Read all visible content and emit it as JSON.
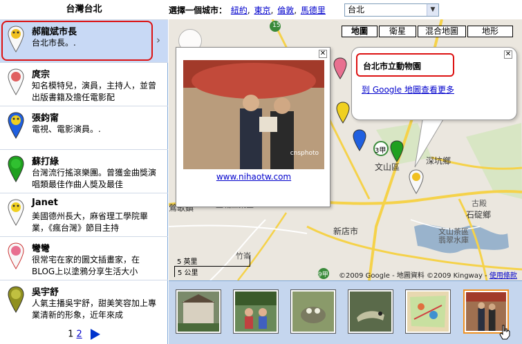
{
  "header": {
    "city_title": "台灣台北",
    "select_label": "選擇一個城市：",
    "city_links": [
      "紐約",
      "東京",
      "倫敦",
      "馬德里"
    ],
    "city_select_value": "台北"
  },
  "people": [
    {
      "name": "郝龍斌市長",
      "desc": "台北市長。.",
      "pin_color": "#f0c020",
      "active": true
    },
    {
      "name": "庹宗",
      "desc": "知名模特兒，演員，主持人，並曾出版書籍及擔任電影配",
      "pin_color": "#e06060",
      "active": false
    },
    {
      "name": "張鈞甯",
      "desc": "電視、電影演員。.",
      "pin_color": "#2060e0",
      "active": false
    },
    {
      "name": "蘇打綠",
      "desc": "台灣流行搖滾樂團。曾獲金曲獎演唱類最佳作曲人獎及最佳",
      "pin_color": "#20a020",
      "active": false
    },
    {
      "name": "Janet",
      "desc": "美國德州長大，麻省理工學院畢業，《瘋台灣》節目主持",
      "pin_color": "#f0d020",
      "active": false
    },
    {
      "name": "彎彎",
      "desc": "很常宅在家的圖文插畫家，在BLOG上以塗鴉分享生活大小",
      "pin_color": "#e87090",
      "active": false
    },
    {
      "name": "吳宇舒",
      "desc": "人氣主播吳宇舒，甜美笑容加上專業清新的形象，近年來成",
      "pin_color": "#909020",
      "active": false
    }
  ],
  "pager": {
    "page1": "1",
    "page2": "2"
  },
  "map": {
    "types": [
      "地圖",
      "衛星",
      "混合地圖",
      "地形"
    ],
    "active_type": "地圖",
    "photo_popup": {
      "link": "www.nihaotw.com",
      "watermark": "cnsphoto"
    },
    "info_balloon": {
      "title": "台北市立動物園",
      "link": "到 Google 地圖查看更多"
    },
    "labels": {
      "wenshan": "文山區",
      "shenkeng": "深坑鄉",
      "xindian": "新店市",
      "shiding": "石碇鄉",
      "tucheng": "土城工業區",
      "qiange": "鶯歌鎮",
      "wenshan_water": "文山茶區\n翡翠水庫",
      "zhuang": "竹崙",
      "gaoshi": "古殿",
      "route_15": "15",
      "route_3": "3甲",
      "route_9": "9甲"
    },
    "scale_km": "5 英里",
    "scale_mi": "5 公里",
    "copyright_text": "©2009 Google - 地圖資料 ©2009 Kingway - ",
    "terms_link": "使用條款"
  },
  "thumbnails": [
    {
      "name": "thumb-1",
      "color": "#7a8a6a"
    },
    {
      "name": "thumb-2",
      "color": "#6a8a5a"
    },
    {
      "name": "thumb-3",
      "color": "#8a9a6a"
    },
    {
      "name": "thumb-4",
      "color": "#5a6a4a"
    },
    {
      "name": "thumb-5",
      "color": "#c8b080"
    },
    {
      "name": "thumb-6",
      "color": "#a07050"
    }
  ]
}
